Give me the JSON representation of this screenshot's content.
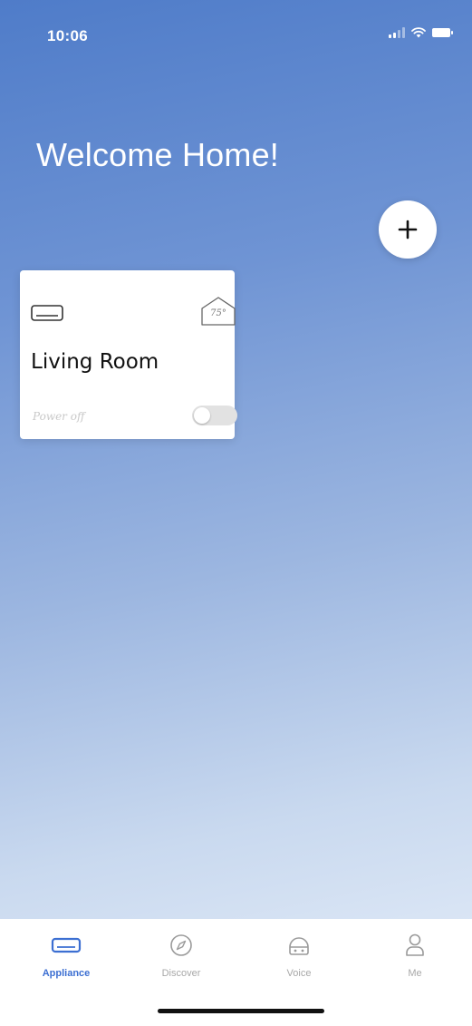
{
  "status_bar": {
    "time": "10:06",
    "signal_icon": "signal-icon",
    "wifi_icon": "wifi-icon",
    "battery_icon": "battery-icon"
  },
  "header": {
    "title": "Welcome Home!",
    "add_icon": "plus-icon"
  },
  "rooms": [
    {
      "name": "Living Room",
      "appliance_icon": "air-conditioner-icon",
      "temperature": "75°",
      "temperature_icon": "home-thermometer-icon",
      "power_status": "Power off",
      "power_on": false
    }
  ],
  "tab_bar": {
    "tabs": [
      {
        "label": "Appliance",
        "icon": "appliance-icon",
        "active": true
      },
      {
        "label": "Discover",
        "icon": "compass-icon",
        "active": false
      },
      {
        "label": "Voice",
        "icon": "voice-assistant-icon",
        "active": false
      },
      {
        "label": "Me",
        "icon": "profile-icon",
        "active": false
      }
    ]
  },
  "colors": {
    "accent": "#3c6fd2",
    "background_top": "#4f7cc9",
    "background_bottom": "#e6eef9",
    "inactive_tab": "#a8a8a8"
  }
}
